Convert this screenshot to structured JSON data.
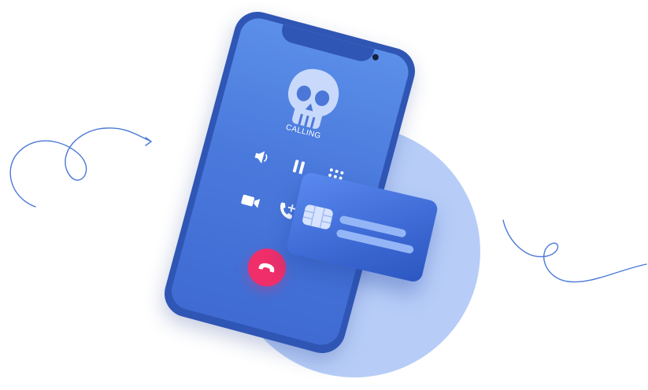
{
  "call": {
    "status_text": "CALLING"
  },
  "icons": {
    "caller": "skull-icon",
    "speaker": "speaker-icon",
    "pause": "pause-icon",
    "keypad": "keypad-icon",
    "video": "video-icon",
    "add_call": "add-call-icon",
    "end_call": "end-call-icon",
    "card_chip": "card-chip-icon"
  },
  "colors": {
    "phone_frame": "#2f56b4",
    "screen_top": "#5b8fe9",
    "screen_bottom": "#3f6bd2",
    "end_call": "#ef2e6a",
    "background_circle": "#b7cdf8",
    "card": "#3f6bd6",
    "swirl_stroke": "#4b78d8"
  }
}
